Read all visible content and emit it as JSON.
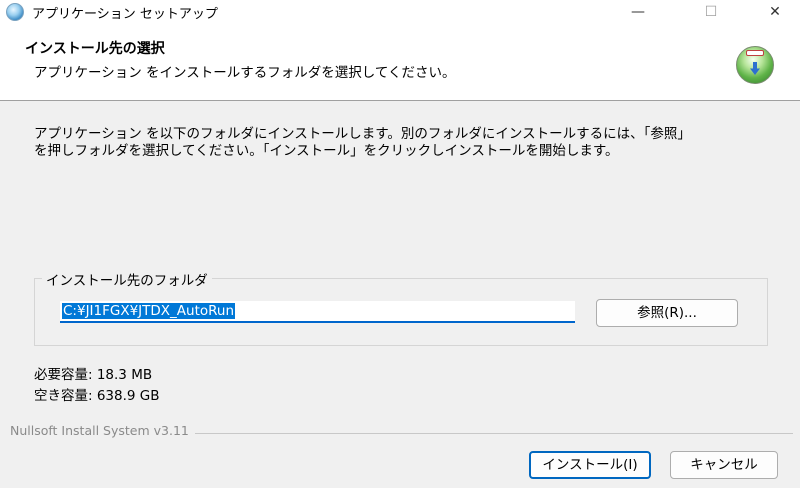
{
  "window": {
    "title": "アプリケーション セットアップ",
    "minimize_glyph": "—",
    "maximize_glyph": "☐",
    "close_glyph": "✕"
  },
  "header": {
    "title": "インストール先の選択",
    "subtitle": "アプリケーション をインストールするフォルダを選択してください。"
  },
  "description": {
    "line1": "アプリケーション を以下のフォルダにインストールします。別のフォルダにインストールするには、「参照」",
    "line2": "を押しフォルダを選択してください。「インストール」をクリックしインストールを開始します。"
  },
  "destination": {
    "group_label": "インストール先のフォルダ",
    "path_value": "C:¥JI1FGX¥JTDX_AutoRun",
    "browse_label": "参照(R)..."
  },
  "space": {
    "required": "必要容量: 18.3 MB",
    "available": "空き容量: 638.9 GB"
  },
  "footer": {
    "branding": "Nullsoft Install System v3.11",
    "install_label": "インストール(I)",
    "cancel_label": "キャンセル"
  },
  "icons": {
    "app": "installer-app-icon",
    "header": "install-disk-icon"
  }
}
